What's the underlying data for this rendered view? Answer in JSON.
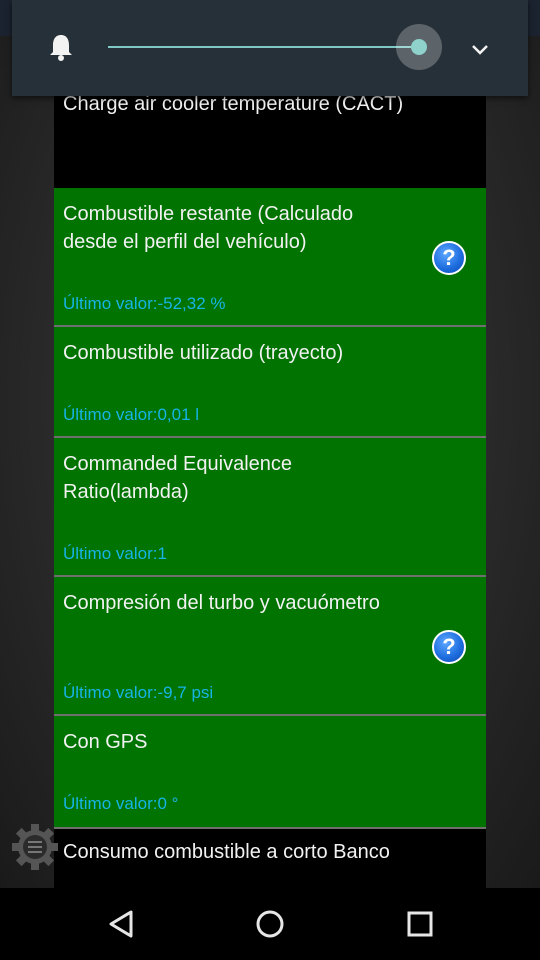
{
  "list": {
    "top_item": {
      "title": "Charge air cooler temperature (CACT)"
    },
    "items": [
      {
        "title": "Combustible restante (Calculado desde el perfil del vehículo)",
        "value": "Último valor:-52,32 %",
        "help": "?"
      },
      {
        "title": "Combustible utilizado (trayecto)",
        "value": "Último valor:0,01 l"
      },
      {
        "title": "Commanded Equivalence Ratio(lambda)",
        "value": "Último valor:1"
      },
      {
        "title": "Compresión del turbo y vacuómetro",
        "value": "Último valor:-9,7 psi",
        "help": "?"
      },
      {
        "title": "Con GPS",
        "value": "Último valor:0 °"
      }
    ],
    "bottom_item": {
      "title": "Consumo combustible a corto Banco"
    }
  },
  "volume_panel": {
    "icon": "bell-icon",
    "level": 0.96,
    "expand_icon": "chevron-down-icon"
  },
  "colors": {
    "item_background": "#007300",
    "value_text": "#16b4e6",
    "slider_accent": "#7fc8c3"
  },
  "navbar": {
    "buttons": [
      "back-icon",
      "home-icon",
      "recents-icon"
    ]
  }
}
